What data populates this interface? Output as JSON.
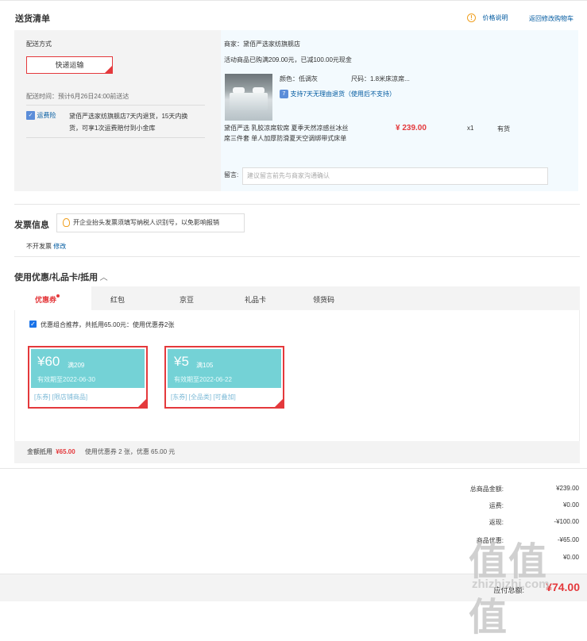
{
  "shipping": {
    "title": "送货清单",
    "price_note_icon": "info-icon",
    "price_note": "价格说明",
    "back_to_cart": "返回修改购物车",
    "method_label": "配送方式",
    "express_button": "快递运输",
    "delivery_time": "配送时间：预计6月26日24:00前送达",
    "insurance_badge": "运费险",
    "insurance_text_1": "黛佰严选家纺旗舰店7天内退货，15天内换",
    "insurance_text_2": "货，可享1次运费赔付到小金库"
  },
  "store": {
    "name": "商家：黛佰严选家纺旗舰店",
    "promo": "活动商品已购满209.00元，已减100.00元现金",
    "color": "颜色：低调灰",
    "size": "尺码：1.8米床凉席...",
    "return_policy": "支持7天无理由退货（使用后不支持）",
    "product_title_1": "黛佰严选 乳胶凉席软席 夏季天然凉感丝冰丝",
    "product_title_2": "席三件套 单人加厚防滑夏天空调绑带式床单",
    "price": "¥ 239.00",
    "qty": "x1",
    "stock": "有货",
    "message_label": "留言:",
    "message_placeholder": "建议留言前先与商家沟通确认"
  },
  "invoice": {
    "title": "发票信息",
    "tip": "开企业抬头发票须填写纳税人识别号，以免影响报销",
    "status": "不开发票",
    "modify": "修改"
  },
  "coupons": {
    "title": "使用优惠/礼品卡/抵用",
    "tabs": [
      "优惠券",
      "红包",
      "京豆",
      "礼品卡",
      "领货码"
    ],
    "combo_text": "优惠组合推荐，共抵用65.00元：使用优惠券2张",
    "items": [
      {
        "amount": "¥60",
        "cond": "满209",
        "valid": "有效期至2022-06-30",
        "tags": "[东券] [限店铺商品]"
      },
      {
        "amount": "¥5",
        "cond": "满105",
        "valid": "有效期至2022-06-22",
        "tags": "[东券] [全品类] [可叠加]"
      }
    ],
    "deduct_label": "金额抵用",
    "deduct_amount": "¥65.00",
    "deduct_detail": "使用优惠券 2 张，优惠 65.00 元"
  },
  "totals": {
    "rows": [
      {
        "label": "总商品金额:",
        "value": "¥239.00"
      },
      {
        "label": "运费:",
        "value": "¥0.00"
      },
      {
        "label": "返现:",
        "value": "-¥100.00"
      },
      {
        "label": "商品优惠:",
        "value": "-¥65.00"
      },
      {
        "label": "",
        "value": "¥0.00"
      }
    ],
    "payable_label": "应付总额:",
    "payable_value": "¥74.00"
  },
  "watermark": {
    "logo": "值",
    "url": "zhizhizhi.com"
  },
  "colors": {
    "accent": "#e4393c",
    "link": "#005aa0",
    "coupon": "#74d2d6"
  }
}
